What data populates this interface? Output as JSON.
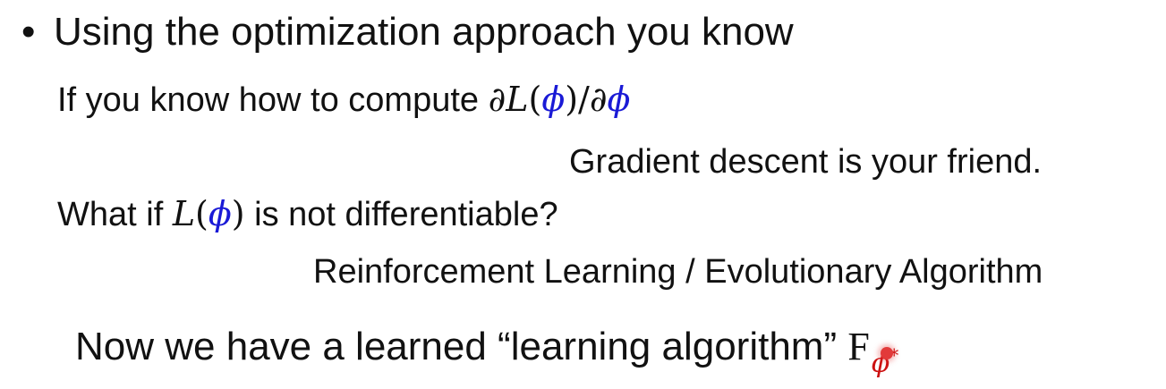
{
  "bullet": {
    "symbol": "•",
    "text": "Using the optimization approach you know"
  },
  "line1": {
    "text": "If you know how to compute ",
    "math_partial": "∂",
    "math_L": "L",
    "paren_open": "(",
    "phi": "ϕ",
    "paren_close": ")",
    "slash": "/",
    "math_partial2": "∂",
    "phi2": "ϕ"
  },
  "line2": {
    "text": "Gradient descent is your friend."
  },
  "line3": {
    "prefix": "What if ",
    "math_L": "L",
    "paren_open": "(",
    "phi": "ϕ",
    "paren_close": ")",
    "suffix": " is not differentiable?"
  },
  "line4": {
    "text": "Reinforcement Learning / Evolutionary Algorithm"
  },
  "line5": {
    "text": "Now we have a learned “learning algorithm” ",
    "F": "F",
    "sub_phi": "ϕ",
    "sub_star": "*"
  },
  "colors": {
    "phi_blue": "#1a1ad6",
    "subscript_red": "#cc1111",
    "cursor_red": "#e23a3a"
  }
}
